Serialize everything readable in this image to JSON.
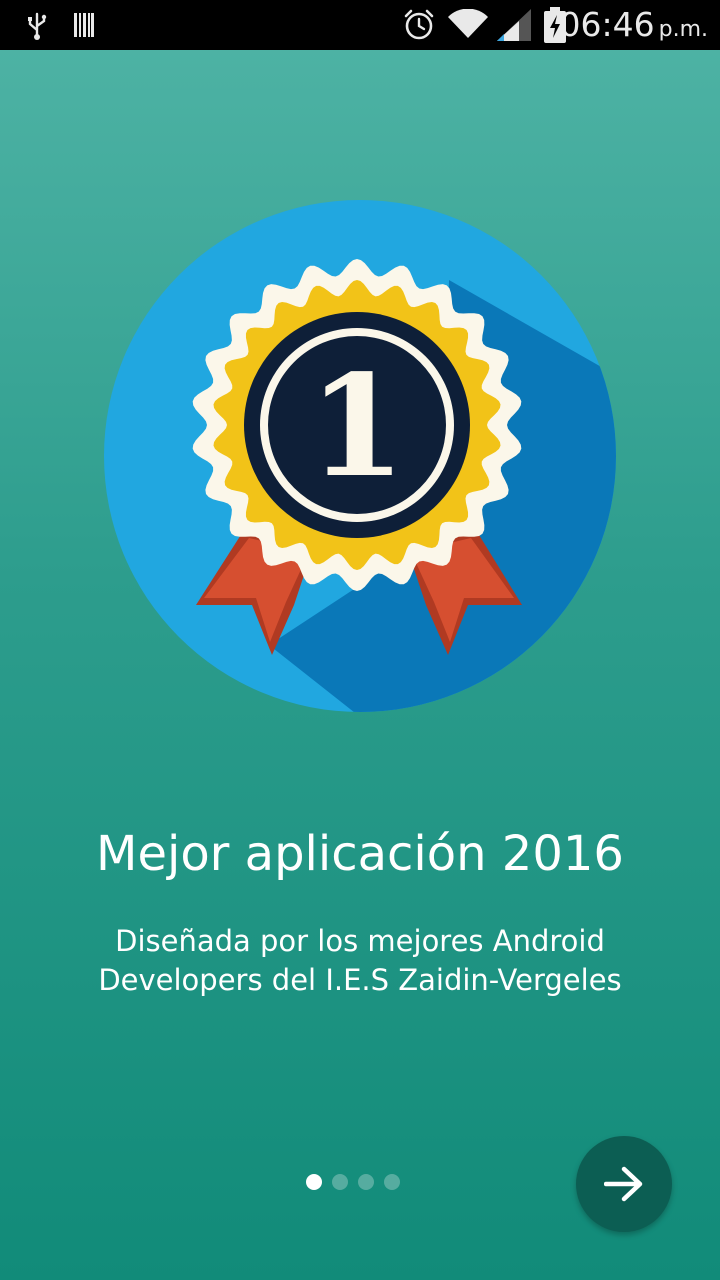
{
  "status_bar": {
    "time": "06:46",
    "ampm": "p.m.",
    "icons": [
      "usb-icon",
      "barcode-icon",
      "alarm-icon",
      "wifi-icon",
      "signal-icon",
      "battery-charging-icon"
    ]
  },
  "onboarding": {
    "title": "Mejor aplicación 2016",
    "description_line1": "Diseñada por los mejores Android",
    "description_line2": "Developers del I.E.S Zaidin-Vergeles",
    "illustration": "award-ribbon-icon",
    "badge_number": "1",
    "pages_total": 4,
    "current_page": 1,
    "next_icon": "arrow-right-icon"
  },
  "colors": {
    "background_top": "#50b4a6",
    "background_bottom": "#118b79",
    "circle": "#21a7e0",
    "circle_shadow": "#0a78b8",
    "rosette_outer": "#fbf7ea",
    "rosette_gold": "#f2c318",
    "badge_dark": "#0e1f38",
    "ribbon": "#d64f30",
    "next_button": "#0c5e53"
  }
}
